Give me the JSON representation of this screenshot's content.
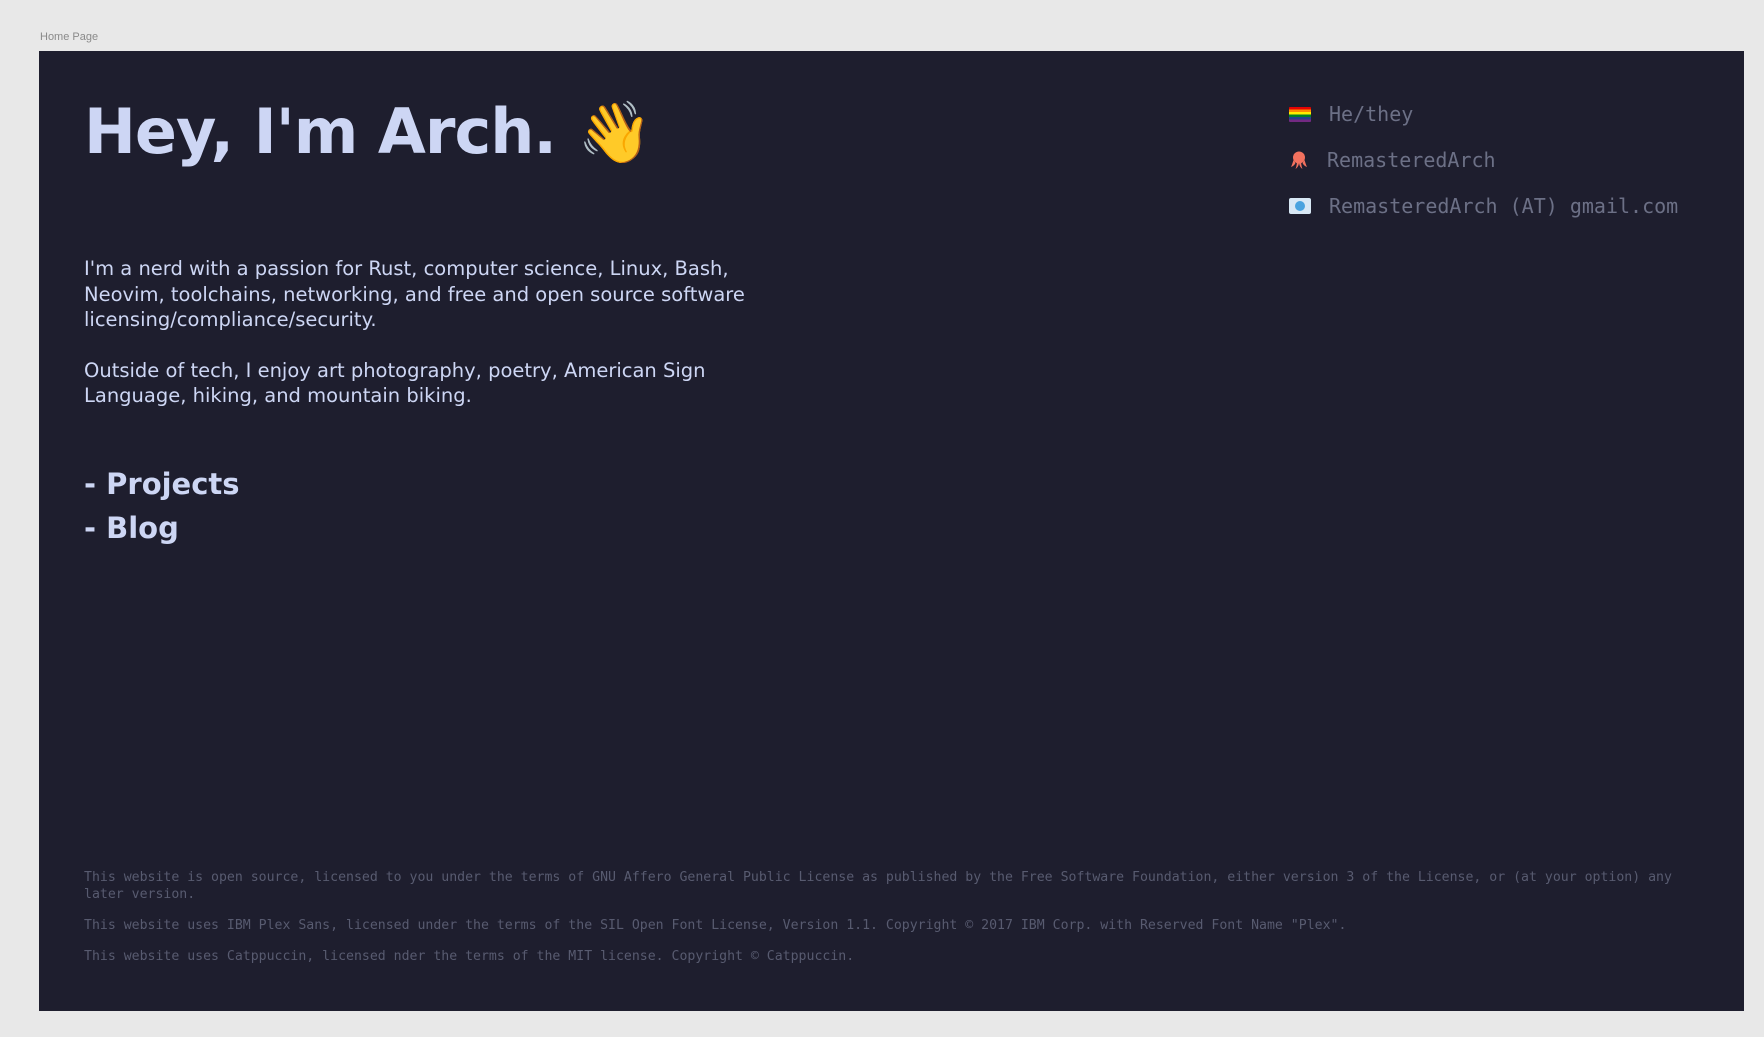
{
  "frame": {
    "label": "Home Page"
  },
  "hero": {
    "title": "Hey, I'm Arch.",
    "wave_emoji": "👋"
  },
  "bio": {
    "paragraphs": [
      "I'm a nerd with a passion for Rust, computer science, Linux, Bash, Neovim, toolchains, networking, and free and open source software licensing/compliance/security.",
      "Outside of tech, I enjoy art photography, poetry, American Sign Language, hiking, and mountain biking."
    ]
  },
  "nav": {
    "items": [
      {
        "label": "- Projects"
      },
      {
        "label": "- Blog"
      }
    ]
  },
  "contacts": {
    "items": [
      {
        "icon": "pride-flag-icon",
        "label": "He/they"
      },
      {
        "icon": "github-octocat-icon",
        "label": "RemasteredArch"
      },
      {
        "icon": "email-icon",
        "label": "RemasteredArch (AT) gmail.com"
      }
    ]
  },
  "footer": {
    "lines": [
      "This website is open source, licensed to you under the terms of GNU Affero General Public License as published by the Free Software Foundation, either version 3 of the License, or (at your option) any later version.",
      "This website uses IBM Plex Sans, licensed under the terms of the SIL Open Font License, Version 1.1. Copyright © 2017 IBM Corp. with Reserved Font Name \"Plex\".",
      "This website uses Catppuccin, licensed nder the terms of the MIT license. Copyright © Catppuccin."
    ]
  },
  "colors": {
    "background": "#1e1e2e",
    "text": "#cdd6f4",
    "muted": "#6c7086",
    "footer": "#585b70",
    "canvas": "#e8e8e8"
  }
}
